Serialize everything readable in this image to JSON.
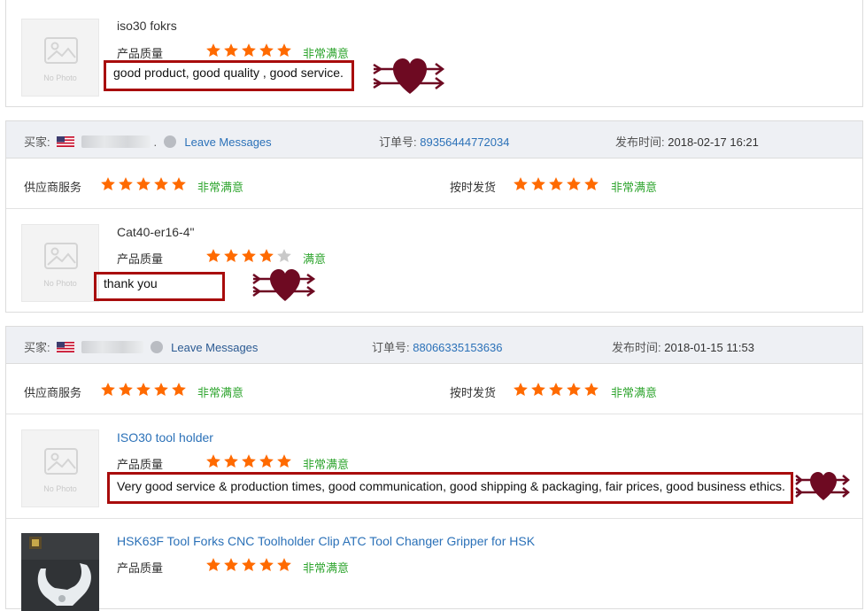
{
  "reviews": [
    {
      "product_title": "iso30 fokrs",
      "quality_label": "产品质量",
      "quality_rating": 5,
      "quality_text": "非常满意",
      "comment": "good product, good quality , good service.",
      "no_photo": "No Photo"
    },
    {
      "buyer_label": "买家:",
      "buyer_suffix": ".",
      "leave_messages": "Leave Messages",
      "order_label": "订单号:",
      "order_number": "89356444772034",
      "time_label": "发布时间:",
      "time": "2018-02-17 16:21",
      "supplier_label": "供应商服务",
      "supplier_rating": 5,
      "supplier_text": "非常满意",
      "ontime_label": "按时发货",
      "ontime_rating": 5,
      "ontime_text": "非常满意",
      "product_title": "Cat40-er16-4\"",
      "quality_label": "产品质量",
      "quality_rating": 4,
      "quality_text": "满意",
      "comment": "thank you",
      "no_photo": "No Photo"
    },
    {
      "buyer_label": "买家:",
      "leave_messages": "Leave Messages",
      "order_label": "订单号:",
      "order_number": "88066335153636",
      "time_label": "发布时间:",
      "time": "2018-01-15 11:53",
      "supplier_label": "供应商服务",
      "supplier_rating": 5,
      "supplier_text": "非常满意",
      "ontime_label": "按时发货",
      "ontime_rating": 5,
      "ontime_text": "非常满意",
      "items": [
        {
          "product_title": "ISO30 tool holder",
          "quality_label": "产品质量",
          "quality_rating": 5,
          "quality_text": "非常满意",
          "comment": "Very good service & production times, good communication, good shipping & packaging, fair prices, good business ethics.",
          "no_photo": "No Photo"
        },
        {
          "product_title": "HSK63F Tool Forks CNC Toolholder Clip ATC Tool Changer Gripper for HSK",
          "quality_label": "产品质量",
          "quality_rating": 5,
          "quality_text": "非常满意"
        }
      ]
    }
  ],
  "colors": {
    "star_on": "#ff6a00",
    "star_off": "#c9c9c9",
    "satisfied": "#2fa52f",
    "link": "#2b71b8",
    "highlight_box": "#a80c0c",
    "heart": "#6e0a22"
  },
  "icons": [
    "star-icon",
    "no-photo-icon",
    "us-flag-icon",
    "avatar-icon",
    "heart-arrows-icon"
  ]
}
